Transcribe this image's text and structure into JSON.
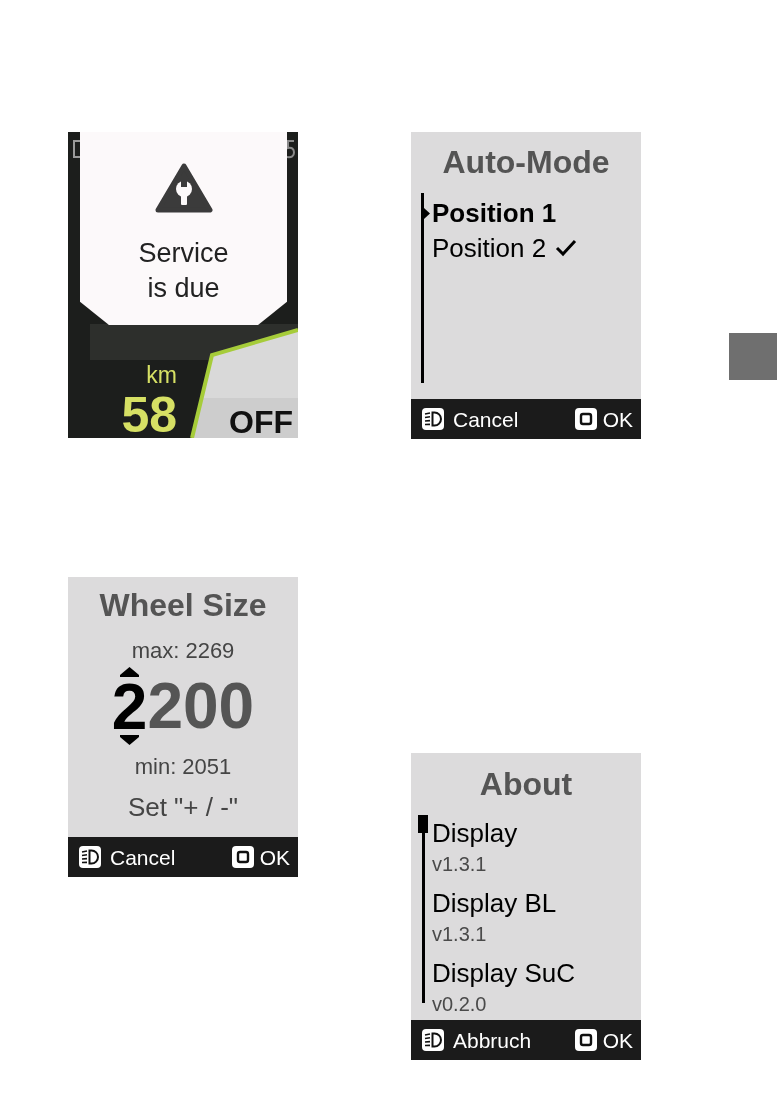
{
  "service_alert": {
    "popup": {
      "message": "Service is due"
    },
    "dashboard": {
      "distance_unit": "km",
      "distance": "58",
      "mode": "OFF"
    }
  },
  "auto_mode": {
    "title": "Auto-Mode",
    "options": [
      {
        "label": "Position 1",
        "selected": true,
        "checked": false
      },
      {
        "label": "Position 2",
        "selected": false,
        "checked": true
      }
    ],
    "footer": {
      "left_label": "Cancel",
      "right_label": "OK"
    }
  },
  "wheel_size": {
    "title": "Wheel Size",
    "max": "max: 2269",
    "digits": [
      {
        "text": "2",
        "selected": true
      },
      {
        "text": "2",
        "selected": false
      },
      {
        "text": "0",
        "selected": false
      },
      {
        "text": "0",
        "selected": false
      }
    ],
    "min": "min: 2051",
    "instruction": "Set \"+ / -\"",
    "footer": {
      "left_label": "Cancel",
      "right_label": "OK"
    }
  },
  "about": {
    "title": "About",
    "items": [
      {
        "name": "Display",
        "version": "v1.3.1"
      },
      {
        "name": "Display BL",
        "version": "v1.3.1"
      },
      {
        "name": "Display SuC",
        "version": "v0.2.0"
      }
    ],
    "footer": {
      "left_label": "Abbruch",
      "right_label": "OK"
    }
  }
}
